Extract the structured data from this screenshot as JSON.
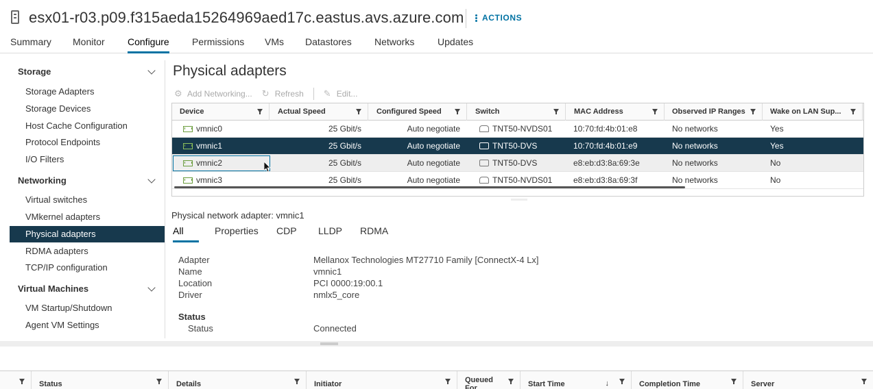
{
  "header": {
    "host_name": "esx01-r03.p09.f315aeda15264969aed17c.eastus.avs.azure.com",
    "actions_label": "ACTIONS"
  },
  "tabs": [
    "Summary",
    "Monitor",
    "Configure",
    "Permissions",
    "VMs",
    "Datastores",
    "Networks",
    "Updates"
  ],
  "active_tab": "Configure",
  "sidebar": {
    "sections": [
      {
        "label": "Storage",
        "items": [
          "Storage Adapters",
          "Storage Devices",
          "Host Cache Configuration",
          "Protocol Endpoints",
          "I/O Filters"
        ]
      },
      {
        "label": "Networking",
        "items": [
          "Virtual switches",
          "VMkernel adapters",
          "Physical adapters",
          "RDMA adapters",
          "TCP/IP configuration"
        ]
      },
      {
        "label": "Virtual Machines",
        "items": [
          "VM Startup/Shutdown",
          "Agent VM Settings"
        ]
      }
    ],
    "selected_item": "Physical adapters"
  },
  "main": {
    "title": "Physical adapters",
    "toolbar": {
      "add_networking": "Add Networking...",
      "refresh": "Refresh",
      "edit": "Edit..."
    },
    "grid": {
      "columns": [
        "Device",
        "Actual Speed",
        "Configured Speed",
        "Switch",
        "MAC Address",
        "Observed IP Ranges",
        "Wake on LAN Sup..."
      ],
      "rows": [
        {
          "device": "vmnic0",
          "actual_speed": "25 Gbit/s",
          "configured_speed": "Auto negotiate",
          "switch": "TNT50-NVDS01",
          "mac": "10:70:fd:4b:01:e8",
          "ip_ranges": "No networks",
          "wol": "Yes"
        },
        {
          "device": "vmnic1",
          "actual_speed": "25 Gbit/s",
          "configured_speed": "Auto negotiate",
          "switch": "TNT50-DVS",
          "mac": "10:70:fd:4b:01:e9",
          "ip_ranges": "No networks",
          "wol": "Yes"
        },
        {
          "device": "vmnic2",
          "actual_speed": "25 Gbit/s",
          "configured_speed": "Auto negotiate",
          "switch": "TNT50-DVS",
          "mac": "e8:eb:d3:8a:69:3e",
          "ip_ranges": "No networks",
          "wol": "No"
        },
        {
          "device": "vmnic3",
          "actual_speed": "25 Gbit/s",
          "configured_speed": "Auto negotiate",
          "switch": "TNT50-NVDS01",
          "mac": "e8:eb:d3:8a:69:3f",
          "ip_ranges": "No networks",
          "wol": "No"
        }
      ],
      "selected_device": "vmnic1"
    },
    "details": {
      "title": "Physical network adapter: vmnic1",
      "tabs": [
        "All",
        "Properties",
        "CDP",
        "LLDP",
        "RDMA"
      ],
      "active_tab": "All",
      "fields": [
        {
          "key": "Adapter",
          "value": "Mellanox Technologies MT27710 Family [ConnectX-4 Lx]"
        },
        {
          "key": "Name",
          "value": "vmnic1"
        },
        {
          "key": "Location",
          "value": "PCI 0000:19:00.1"
        },
        {
          "key": "Driver",
          "value": "nmlx5_core"
        }
      ],
      "status_section": "Status",
      "status_fields": [
        {
          "key": "Status",
          "value": "Connected"
        }
      ]
    }
  },
  "tasks": {
    "columns": [
      "Status",
      "Details",
      "Initiator",
      "Queued For",
      "Start Time",
      "Completion Time",
      "Server"
    ]
  },
  "colors": {
    "accent": "#0072a3",
    "selection": "#17394d",
    "nic_icon": "#6a9c3c"
  }
}
